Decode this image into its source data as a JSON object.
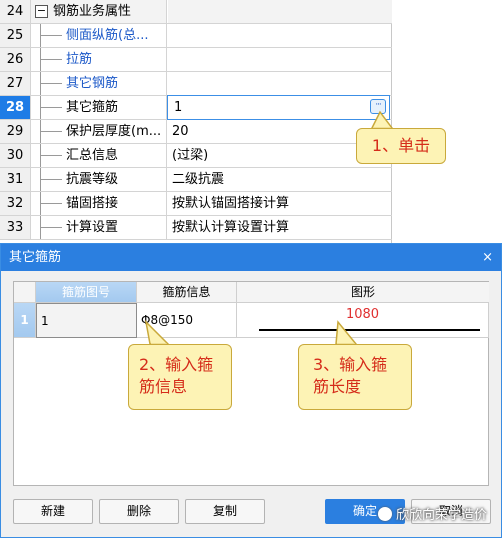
{
  "property_grid": {
    "rows": [
      {
        "num": "24",
        "name": "钢筋业务属性",
        "value": ""
      },
      {
        "num": "25",
        "name": "侧面纵筋(总...",
        "value": ""
      },
      {
        "num": "26",
        "name": "拉筋",
        "value": ""
      },
      {
        "num": "27",
        "name": "其它钢筋",
        "value": ""
      },
      {
        "num": "28",
        "name": "其它箍筋",
        "value": "1"
      },
      {
        "num": "29",
        "name": "保护层厚度(m...",
        "value": "20"
      },
      {
        "num": "30",
        "name": "汇总信息",
        "value": "(过梁)"
      },
      {
        "num": "31",
        "name": "抗震等级",
        "value": "二级抗震"
      },
      {
        "num": "32",
        "name": "锚固搭接",
        "value": "按默认锚固搭接计算"
      },
      {
        "num": "33",
        "name": "计算设置",
        "value": "按默认计算设置计算"
      }
    ],
    "collapse_symbol": "−",
    "ellipsis": "···"
  },
  "callouts": {
    "c1": "1、单击",
    "c2_line1": "2、输入箍",
    "c2_line2": "筋信息",
    "c3_line1": "3、输入箍",
    "c3_line2": "筋长度"
  },
  "dialog": {
    "title": "其它箍筋",
    "close": "×",
    "columns": {
      "id": "箍筋图号",
      "info": "箍筋信息",
      "shape": "图形"
    },
    "rows": [
      {
        "num": "1",
        "id": "1",
        "info": "Φ8@150",
        "length": "1080"
      }
    ],
    "buttons": {
      "new": "新建",
      "delete": "删除",
      "copy": "复制",
      "ok": "确定",
      "cancel": "取消"
    }
  },
  "watermark": "欣欣向荣学造价"
}
